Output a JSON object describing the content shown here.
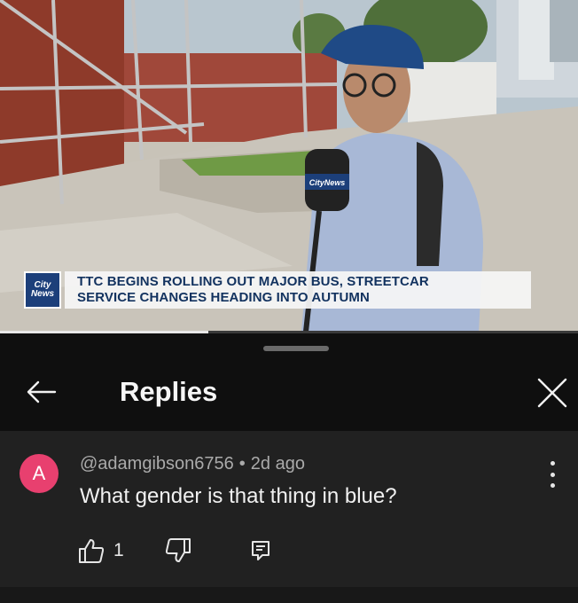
{
  "video": {
    "logo_line1": "City",
    "logo_line2": "News",
    "headline_line1": "TTC BEGINS ROLLING OUT MAJOR BUS, STREETCAR",
    "headline_line2": "SERVICE CHANGES HEADING INTO AUTUMN",
    "mic_label": "CityNews",
    "progress_fraction": 0.36
  },
  "sheet": {
    "title": "Replies",
    "back_icon": "arrow-left-icon",
    "close_icon": "close-icon"
  },
  "comment": {
    "avatar_letter": "A",
    "avatar_color": "#e8406f",
    "author": "@adamgibson6756",
    "separator": "•",
    "time": "2d ago",
    "text": "What gender is that thing in blue?",
    "like_count": "1",
    "icons": [
      "thumbs-up-icon",
      "thumbs-down-icon",
      "reply-icon",
      "more-vert-icon"
    ]
  },
  "colors": {
    "sheet_header_bg": "#0f0f0f",
    "comment_bg": "#212121",
    "text_primary": "#f1f1f1",
    "text_secondary": "#aaaaaa",
    "news_navy": "#12325f"
  }
}
